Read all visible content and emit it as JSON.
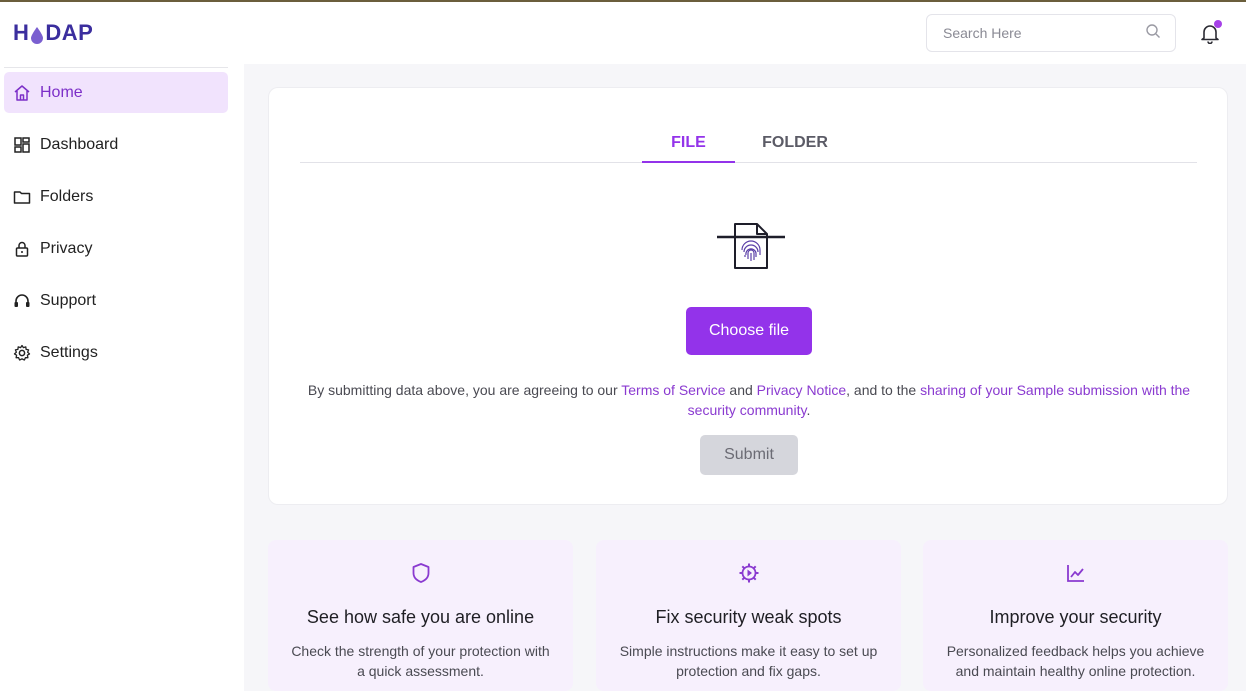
{
  "app": {
    "logo_left": "H",
    "logo_right": "DAP",
    "brand_color": "#9333ea",
    "logo_color": "#3b2e9e"
  },
  "header": {
    "search_placeholder": "Search Here",
    "search_icon": "search-icon",
    "bell_icon": "bell-icon",
    "notification_dot": true
  },
  "sidebar": {
    "items": [
      {
        "label": "Home",
        "icon": "home-icon",
        "active": true
      },
      {
        "label": "Dashboard",
        "icon": "dashboard-icon",
        "active": false
      },
      {
        "label": "Folders",
        "icon": "folder-icon",
        "active": false
      },
      {
        "label": "Privacy",
        "icon": "lock-icon",
        "active": false
      },
      {
        "label": "Support",
        "icon": "headset-icon",
        "active": false
      },
      {
        "label": "Settings",
        "icon": "gear-icon",
        "active": false
      }
    ]
  },
  "upload": {
    "tabs": [
      {
        "label": "FILE",
        "active": true
      },
      {
        "label": "FOLDER",
        "active": false
      }
    ],
    "file_icon": "fingerprint-file-icon",
    "choose_label": "Choose file",
    "terms": {
      "prefix": "By submitting data above, you are agreeing to our ",
      "link1": "Terms of Service",
      "mid1": " and ",
      "link2": "Privacy Notice",
      "mid2": ", and to the ",
      "link3": "sharing of your Sample submission with the security community",
      "suffix": "."
    },
    "submit_label": "Submit"
  },
  "features": [
    {
      "icon": "shield-icon",
      "title": "See how safe you are online",
      "text": "Check the strength of your protection with a quick assessment."
    },
    {
      "icon": "gear-bolt-icon",
      "title": "Fix security weak spots",
      "text": "Simple instructions make it easy to set up protection and fix gaps."
    },
    {
      "icon": "chart-line-icon",
      "title": "Improve your security",
      "text": "Personalized feedback helps you achieve and maintain healthy online protection."
    }
  ]
}
